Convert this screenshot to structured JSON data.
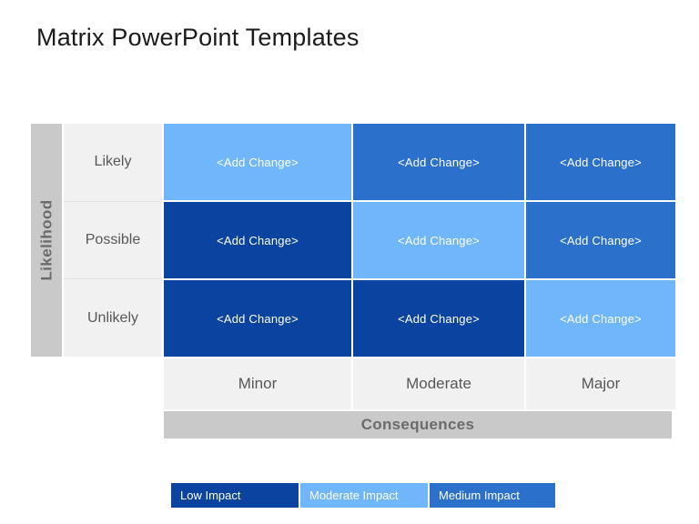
{
  "slide": {
    "title": "Matrix PowerPoint Templates"
  },
  "matrix": {
    "y_axis_label": "Likelihood",
    "x_axis_label": "Consequences",
    "row_headers": [
      "Likely",
      "Possible",
      "Unlikely"
    ],
    "col_headers": [
      "Minor",
      "Moderate",
      "Major"
    ],
    "cell_placeholder": "<Add Change>",
    "cells": [
      [
        {
          "label": "<Add Change>",
          "level": "moderate"
        },
        {
          "label": "<Add Change>",
          "level": "medium"
        },
        {
          "label": "<Add Change>",
          "level": "medium"
        }
      ],
      [
        {
          "label": "<Add Change>",
          "level": "low"
        },
        {
          "label": "<Add Change>",
          "level": "moderate"
        },
        {
          "label": "<Add Change>",
          "level": "medium"
        }
      ],
      [
        {
          "label": "<Add Change>",
          "level": "low"
        },
        {
          "label": "<Add Change>",
          "level": "low"
        },
        {
          "label": "<Add Change>",
          "level": "moderate"
        }
      ]
    ]
  },
  "legend": {
    "items": [
      {
        "label": "Low Impact",
        "level": "low"
      },
      {
        "label": "Moderate Impact",
        "level": "moderate"
      },
      {
        "label": "Medium Impact",
        "level": "medium"
      }
    ]
  },
  "colors": {
    "low": "#0b43a0",
    "medium": "#2b71cc",
    "moderate": "#70b6fa",
    "axis_band": "#c9c9c9",
    "header_cell": "#f1f1f1",
    "title_text": "#1b1b1b",
    "header_text": "#575757",
    "axis_text": "#6b6b6b",
    "background": "#ffffff"
  }
}
